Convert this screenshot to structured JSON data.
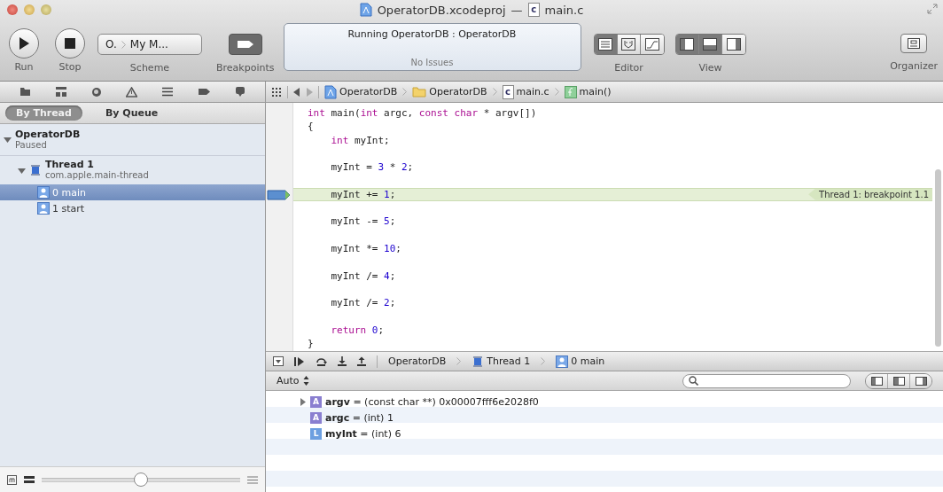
{
  "window": {
    "project": "OperatorDB.xcodeproj",
    "separator": "—",
    "file_icon": "c",
    "file": "main.c"
  },
  "toolbar": {
    "run": "Run",
    "stop": "Stop",
    "scheme": {
      "target": "O.",
      "destination": "My M...",
      "label": "Scheme"
    },
    "breakpoints": {
      "label": "Breakpoints",
      "on": true
    },
    "status": {
      "activity": "Running OperatorDB : OperatorDB",
      "issues": "No Issues"
    },
    "editor": {
      "label": "Editor",
      "segments": [
        {
          "kind": "standard",
          "selected": true
        },
        {
          "kind": "assistant",
          "selected": false
        },
        {
          "kind": "version",
          "selected": false
        }
      ]
    },
    "view": {
      "label": "View",
      "segments": [
        {
          "kind": "navigator",
          "selected": true
        },
        {
          "kind": "debug",
          "selected": true
        },
        {
          "kind": "utilities",
          "selected": false
        }
      ]
    },
    "organizer": "Organizer"
  },
  "navigator": {
    "modes": [
      {
        "label": "By Thread",
        "selected": true
      },
      {
        "label": "By Queue",
        "selected": false
      }
    ],
    "tree": [
      {
        "kind": "process",
        "title": "OperatorDB",
        "subtitle": "Paused",
        "expanded": true,
        "children": [
          {
            "kind": "thread",
            "title": "Thread 1",
            "subtitle": "com.apple.main-thread",
            "expanded": true,
            "children": [
              {
                "kind": "frame",
                "title": "0 main",
                "selected": true
              },
              {
                "kind": "frame",
                "title": "1 start",
                "selected": false
              }
            ]
          }
        ]
      }
    ],
    "slider": {
      "level": 0.5
    }
  },
  "jump_bar": [
    {
      "kind": "project",
      "label": "OperatorDB"
    },
    {
      "kind": "folder",
      "label": "OperatorDB"
    },
    {
      "kind": "cfile",
      "icon": "c",
      "label": "main.c"
    },
    {
      "kind": "function",
      "label": "main()"
    }
  ],
  "code": [
    {
      "kind": "code",
      "current": false,
      "breakpoint": false,
      "tokens": [
        {
          "kind": "keyword",
          "text": "int"
        },
        {
          "kind": "plain",
          "text": " main("
        },
        {
          "kind": "keyword",
          "text": "int"
        },
        {
          "kind": "plain",
          "text": " argc, "
        },
        {
          "kind": "keyword",
          "text": "const"
        },
        {
          "kind": "keyword",
          "text": " char"
        },
        {
          "kind": "plain",
          "text": " * argv[])"
        }
      ]
    },
    {
      "kind": "code",
      "current": false,
      "breakpoint": false,
      "tokens": [
        {
          "kind": "plain",
          "text": "{"
        }
      ]
    },
    {
      "kind": "code",
      "current": false,
      "breakpoint": false,
      "tokens": [
        {
          "kind": "keyword",
          "text": "    int"
        },
        {
          "kind": "plain",
          "text": " myInt;"
        }
      ]
    },
    {
      "kind": "blank"
    },
    {
      "kind": "code",
      "current": false,
      "breakpoint": false,
      "tokens": [
        {
          "kind": "plain",
          "text": "    myInt = "
        },
        {
          "kind": "number",
          "text": "3"
        },
        {
          "kind": "plain",
          "text": " * "
        },
        {
          "kind": "number",
          "text": "2"
        },
        {
          "kind": "plain",
          "text": ";"
        }
      ]
    },
    {
      "kind": "blank"
    },
    {
      "kind": "code",
      "current": true,
      "breakpoint": true,
      "annotation": "Thread 1: breakpoint 1.1",
      "tokens": [
        {
          "kind": "plain",
          "text": "    myInt += "
        },
        {
          "kind": "number",
          "text": "1"
        },
        {
          "kind": "plain",
          "text": ";"
        }
      ]
    },
    {
      "kind": "blank"
    },
    {
      "kind": "code",
      "current": false,
      "breakpoint": false,
      "tokens": [
        {
          "kind": "plain",
          "text": "    myInt -= "
        },
        {
          "kind": "number",
          "text": "5"
        },
        {
          "kind": "plain",
          "text": ";"
        }
      ]
    },
    {
      "kind": "blank"
    },
    {
      "kind": "code",
      "current": false,
      "breakpoint": false,
      "tokens": [
        {
          "kind": "plain",
          "text": "    myInt *= "
        },
        {
          "kind": "number",
          "text": "10"
        },
        {
          "kind": "plain",
          "text": ";"
        }
      ]
    },
    {
      "kind": "blank"
    },
    {
      "kind": "code",
      "current": false,
      "breakpoint": false,
      "tokens": [
        {
          "kind": "plain",
          "text": "    myInt /= "
        },
        {
          "kind": "number",
          "text": "4"
        },
        {
          "kind": "plain",
          "text": ";"
        }
      ]
    },
    {
      "kind": "blank"
    },
    {
      "kind": "code",
      "current": false,
      "breakpoint": false,
      "tokens": [
        {
          "kind": "plain",
          "text": "    myInt /= "
        },
        {
          "kind": "number",
          "text": "2"
        },
        {
          "kind": "plain",
          "text": ";"
        }
      ]
    },
    {
      "kind": "blank"
    },
    {
      "kind": "code",
      "current": false,
      "breakpoint": false,
      "tokens": [
        {
          "kind": "keyword",
          "text": "    return"
        },
        {
          "kind": "number",
          "text": " 0"
        },
        {
          "kind": "plain",
          "text": ";"
        }
      ]
    },
    {
      "kind": "code",
      "current": false,
      "breakpoint": false,
      "tokens": [
        {
          "kind": "plain",
          "text": "}"
        }
      ]
    }
  ],
  "debug_bar": [
    {
      "label": "OperatorDB"
    },
    {
      "kind": "thread",
      "label": "Thread 1"
    },
    {
      "kind": "frame",
      "label": "0 main"
    }
  ],
  "variables": {
    "scope": "Auto",
    "items": [
      {
        "scope": "A",
        "color": "#8a7fd0",
        "name": "argv",
        "value": " = (const char **) 0x00007fff6e2028f0",
        "expandable": true
      },
      {
        "scope": "A",
        "color": "#8a7fd0",
        "name": "argc",
        "value": " = (int) 1",
        "expandable": false
      },
      {
        "scope": "L",
        "color": "#6c9fe0",
        "name": "myInt",
        "value": " = (int) 6",
        "expandable": false
      }
    ]
  }
}
